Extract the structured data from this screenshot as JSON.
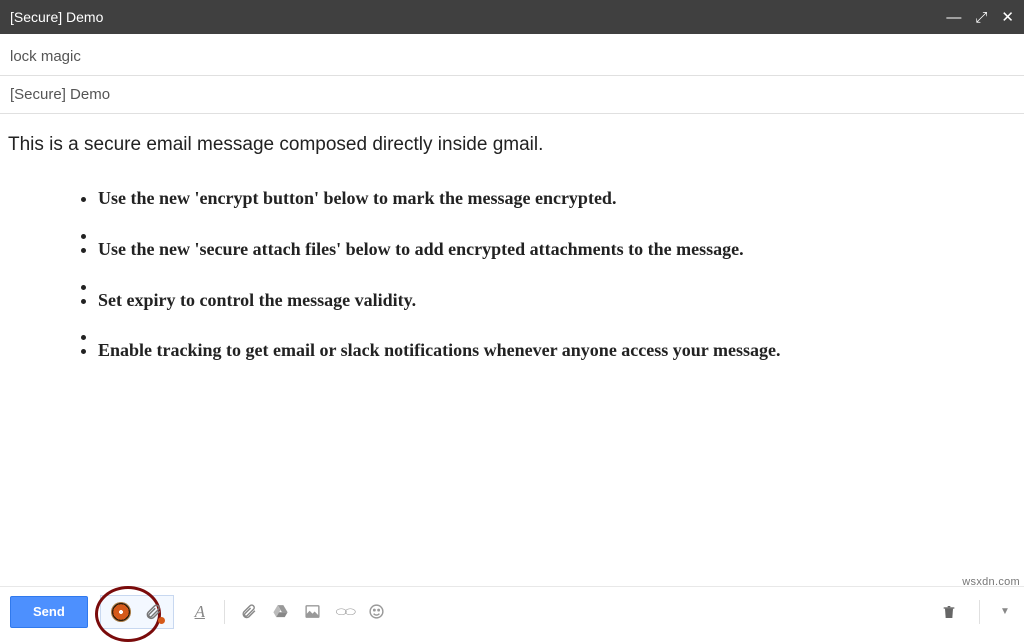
{
  "window": {
    "title": "[Secure] Demo"
  },
  "fields": {
    "to": "lock magic",
    "subject": "[Secure] Demo"
  },
  "body": {
    "intro": "This is a secure email message composed directly inside gmail.",
    "bullets": [
      "Use the new 'encrypt button' below to mark the message encrypted.",
      "Use the new 'secure attach files' below to add encrypted attachments to the message.",
      "Set expiry to control the message validity.",
      "Enable tracking to get email or slack notifications whenever anyone access your message."
    ]
  },
  "toolbar": {
    "send_label": "Send"
  },
  "watermark": "wsxdn.com"
}
